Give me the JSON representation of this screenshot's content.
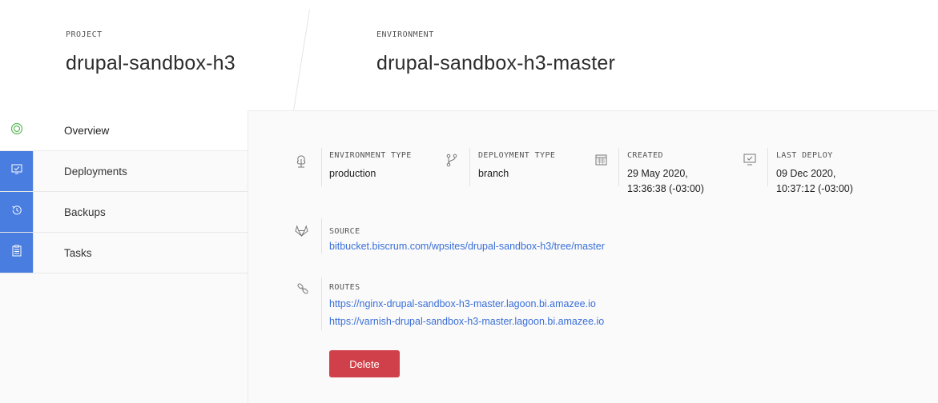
{
  "header": {
    "project_label": "PROJECT",
    "project_name": "drupal-sandbox-h3",
    "environment_label": "ENVIRONMENT",
    "environment_name": "drupal-sandbox-h3-master"
  },
  "sidebar": {
    "items": [
      {
        "label": "Overview",
        "icon": "target-icon",
        "active": true
      },
      {
        "label": "Deployments",
        "icon": "monitor-check-icon",
        "active": false
      },
      {
        "label": "Backups",
        "icon": "history-icon",
        "active": false
      },
      {
        "label": "Tasks",
        "icon": "clipboard-icon",
        "active": false
      }
    ]
  },
  "details": {
    "environment_type": {
      "label": "ENVIRONMENT TYPE",
      "value": "production",
      "icon": "tree-icon"
    },
    "deployment_type": {
      "label": "DEPLOYMENT TYPE",
      "value": "branch",
      "icon": "git-branch-icon"
    },
    "created": {
      "label": "CREATED",
      "date": "29 May 2020,",
      "time": "13:36:38 (-03:00)",
      "icon": "calendar-icon"
    },
    "last_deploy": {
      "label": "LAST DEPLOY",
      "date": "09 Dec 2020,",
      "time": "10:37:12 (-03:00)",
      "icon": "monitor-check-icon"
    },
    "source": {
      "label": "SOURCE",
      "url": "bitbucket.biscrum.com/wpsites/drupal-sandbox-h3/tree/master",
      "icon": "gitlab-icon"
    },
    "routes": {
      "label": "ROUTES",
      "icon": "link-icon",
      "urls": [
        "https://nginx-drupal-sandbox-h3-master.lagoon.bi.amazee.io",
        "https://varnish-drupal-sandbox-h3-master.lagoon.bi.amazee.io"
      ]
    }
  },
  "actions": {
    "delete_label": "Delete"
  },
  "colors": {
    "accent_blue": "#4a7de0",
    "link_blue": "#3a6fd8",
    "delete_red": "#d0404a",
    "active_green": "#5cb85c"
  }
}
